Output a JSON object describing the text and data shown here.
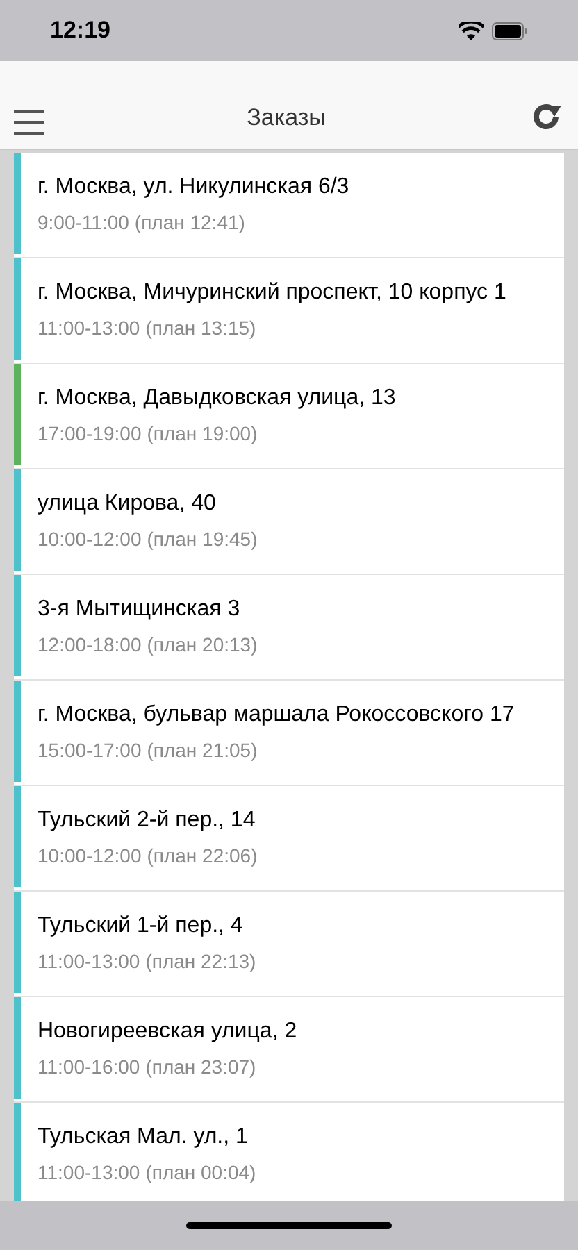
{
  "status_bar": {
    "time": "12:19"
  },
  "header": {
    "title": "Заказы"
  },
  "orders": [
    {
      "address": "г. Москва, ул. Никулинская 6/3",
      "window": "9:00-11:00",
      "plan": "(план 12:41)",
      "color": "#4fc1cb"
    },
    {
      "address": "г. Москва, Мичуринский проспект, 10 корпус 1",
      "window": "11:00-13:00",
      "plan": "(план 13:15)",
      "color": "#4fc1cb"
    },
    {
      "address": "г. Москва, Давыдковская улица, 13",
      "window": "17:00-19:00",
      "plan": "(план 19:00)",
      "color": "#5cb35c"
    },
    {
      "address": "улица Кирова, 40",
      "window": "10:00-12:00",
      "plan": "(план 19:45)",
      "color": "#4fc1cb"
    },
    {
      "address": "3-я Мытищинская 3",
      "window": "12:00-18:00",
      "plan": "(план 20:13)",
      "color": "#4fc1cb"
    },
    {
      "address": "г. Москва, бульвар маршала Рокоссовского 17",
      "window": "15:00-17:00",
      "plan": "(план 21:05)",
      "color": "#4fc1cb"
    },
    {
      "address": "Тульский 2-й пер., 14",
      "window": "10:00-12:00",
      "plan": "(план 22:06)",
      "color": "#4fc1cb"
    },
    {
      "address": "Тульский 1-й пер., 4",
      "window": "11:00-13:00",
      "plan": "(план 22:13)",
      "color": "#4fc1cb"
    },
    {
      "address": "Новогиреевская улица, 2",
      "window": "11:00-16:00",
      "plan": "(план 23:07)",
      "color": "#4fc1cb"
    },
    {
      "address": "Тульская Мал. ул., 1",
      "window": "11:00-13:00",
      "plan": "(план 00:04)",
      "color": "#4fc1cb"
    }
  ]
}
